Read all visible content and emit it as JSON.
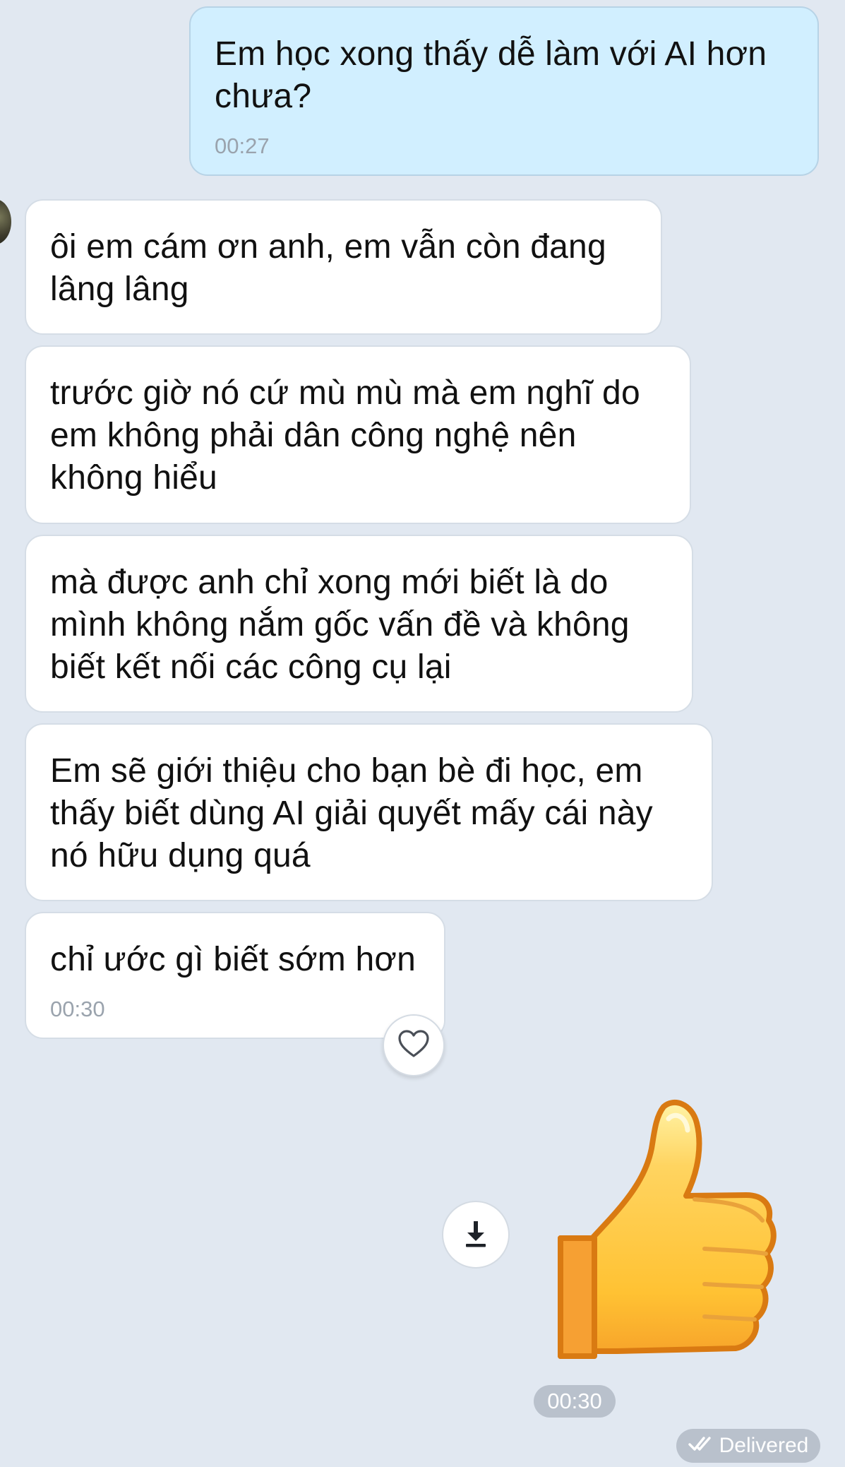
{
  "colors": {
    "background": "#e1e8f1",
    "outgoing_bubble": "#d1efff",
    "incoming_bubble": "#ffffff",
    "timestamp": "#9aa3ad",
    "status_pill": "#b9c1cc"
  },
  "messages": [
    {
      "direction": "outgoing",
      "text": "Em học xong thấy dễ làm với AI hơn\nchưa?",
      "time": "00:27"
    },
    {
      "direction": "incoming",
      "text": "ôi em cám ơn anh, em vẫn còn đang\nlâng lâng"
    },
    {
      "direction": "incoming",
      "text": "trước giờ nó cứ mù mù mà em nghĩ do\nem không phải dân công nghệ nên\nkhông hiểu"
    },
    {
      "direction": "incoming",
      "text": "mà được anh chỉ xong mới biết là do\nmình không nắm gốc vấn đề và không\nbiết kết nối các công cụ lại"
    },
    {
      "direction": "incoming",
      "text": "Em sẽ giới thiệu cho bạn bè đi học, em\nthấy biết dùng AI giải quyết mấy cái này\nnó hữu dụng quá"
    },
    {
      "direction": "incoming",
      "text": "chỉ ước gì biết sớm hơn",
      "time": "00:30"
    }
  ],
  "icons": {
    "reaction": "heart-icon",
    "download": "download-icon",
    "sticker": "thumbs-up-icon",
    "delivered": "double-check-icon"
  },
  "sticker_time": "00:30",
  "status": "Delivered"
}
